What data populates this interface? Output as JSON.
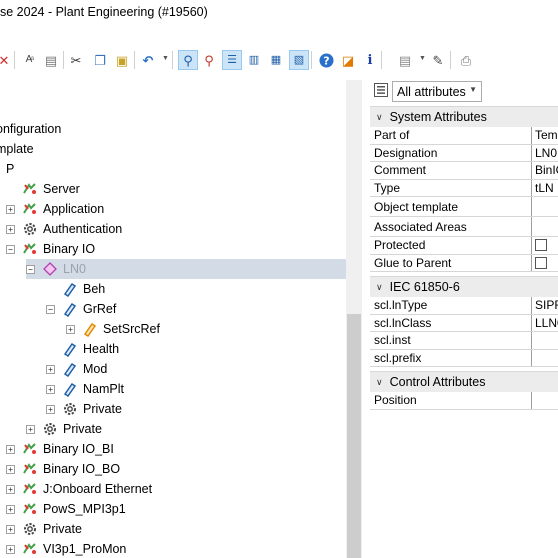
{
  "window": {
    "title": "se 2024 - Plant Engineering (#19560)"
  },
  "toolbar": {
    "icons": [
      "delete-icon",
      "rename-icon",
      "copy-format-icon",
      "cut-icon",
      "copy-icon",
      "paste-icon",
      "undo-icon",
      "find-icon",
      "find-next-icon",
      "list-view-icon",
      "details-view-icon",
      "properties-view-icon",
      "properties-panel-icon",
      "help-icon",
      "bookmark-icon",
      "info-icon",
      "template-icon",
      "edit-icon",
      "print-icon"
    ]
  },
  "tree": {
    "nodes": [
      {
        "label": "onfiguration",
        "indent": 0,
        "expander": "",
        "icon": ""
      },
      {
        "label": "mplate",
        "indent": 0,
        "expander": "",
        "icon": ""
      },
      {
        "label": "P",
        "indent": 6,
        "expander": "",
        "icon": ""
      },
      {
        "label": "Server",
        "indent": 6,
        "expander": "",
        "icon": "device"
      },
      {
        "label": "Application",
        "indent": 6,
        "expander": "+",
        "icon": "device"
      },
      {
        "label": "Authentication",
        "indent": 6,
        "expander": "+",
        "icon": "gear"
      },
      {
        "label": "Binary IO",
        "indent": 6,
        "expander": "−",
        "icon": "device"
      },
      {
        "label": "LN0",
        "indent": 26,
        "expander": "−",
        "icon": "diamond-pink",
        "selected": true
      },
      {
        "label": "Beh",
        "indent": 46,
        "expander": "",
        "icon": "tag-blue"
      },
      {
        "label": "GrRef",
        "indent": 46,
        "expander": "−",
        "icon": "tag-blue"
      },
      {
        "label": "SetSrcRef",
        "indent": 66,
        "expander": "+",
        "icon": "tag-orange"
      },
      {
        "label": "Health",
        "indent": 46,
        "expander": "",
        "icon": "tag-blue"
      },
      {
        "label": "Mod",
        "indent": 46,
        "expander": "+",
        "icon": "tag-blue"
      },
      {
        "label": "NamPlt",
        "indent": 46,
        "expander": "+",
        "icon": "tag-blue"
      },
      {
        "label": "Private",
        "indent": 46,
        "expander": "+",
        "icon": "gear"
      },
      {
        "label": "Private",
        "indent": 26,
        "expander": "+",
        "icon": "gear"
      },
      {
        "label": "Binary IO_BI",
        "indent": 6,
        "expander": "+",
        "icon": "device"
      },
      {
        "label": "Binary IO_BO",
        "indent": 6,
        "expander": "+",
        "icon": "device"
      },
      {
        "label": "J:Onboard Ethernet",
        "indent": 6,
        "expander": "+",
        "icon": "device"
      },
      {
        "label": "PowS_MPI3p1",
        "indent": 6,
        "expander": "+",
        "icon": "device"
      },
      {
        "label": "Private",
        "indent": 6,
        "expander": "+",
        "icon": "gear"
      },
      {
        "label": "VI3p1_ProMon",
        "indent": 6,
        "expander": "+",
        "icon": "device"
      }
    ]
  },
  "attributes": {
    "filter_value": "All attributes",
    "sections": [
      {
        "title": "System Attributes",
        "rows": [
          {
            "key": "Part of",
            "value": "Tem"
          },
          {
            "key": "Designation",
            "value": "LN0"
          },
          {
            "key": "Comment",
            "value": "BinIO"
          },
          {
            "key": "Type",
            "value": "tLN"
          },
          {
            "key": "Object template",
            "value": ""
          },
          {
            "key": "Associated Areas",
            "value": ""
          },
          {
            "key": "Protected",
            "value": "",
            "checkbox": true
          },
          {
            "key": "Glue to Parent",
            "value": "",
            "checkbox": true
          }
        ]
      },
      {
        "title": "IEC 61850-6",
        "rows": [
          {
            "key": "scl.lnType",
            "value": "SIPR"
          },
          {
            "key": "scl.lnClass",
            "value": "LLN0"
          },
          {
            "key": "scl.inst",
            "value": ""
          },
          {
            "key": "scl.prefix",
            "value": ""
          }
        ]
      },
      {
        "title": "Control Attributes",
        "rows": [
          {
            "key": "Position",
            "value": ""
          }
        ]
      }
    ]
  }
}
